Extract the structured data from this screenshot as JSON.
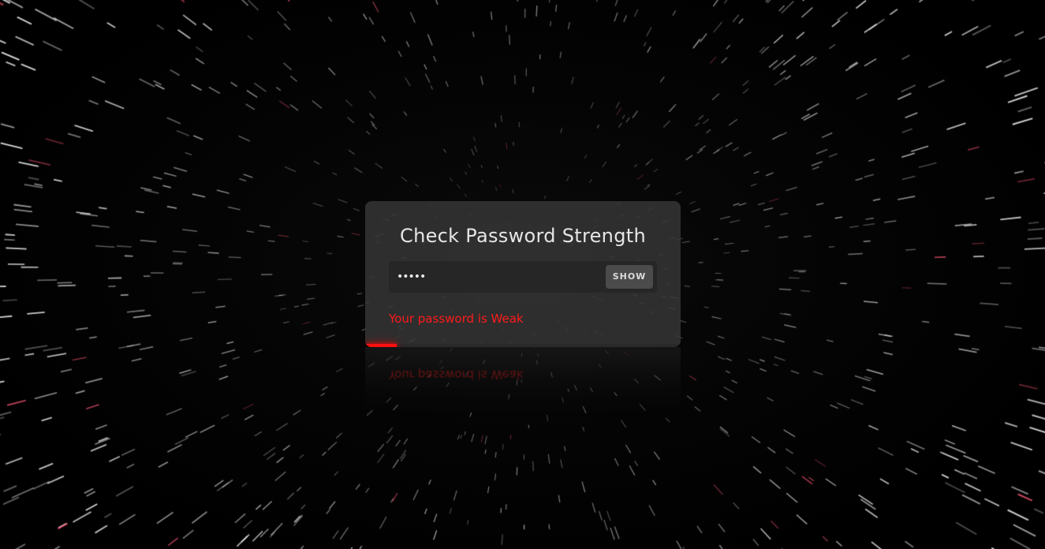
{
  "card": {
    "title": "Check Password Strength",
    "password_value": "•••••",
    "show_label": "SHOW",
    "status_text": "Your password is Weak"
  },
  "strength_meter": {
    "level": "Weak",
    "fill_fraction": 0.1,
    "color": "#ff1010"
  },
  "theme": {
    "background": "#000000",
    "card_background": "#3a3a3a",
    "accent_red": "#ff1a1a"
  },
  "icons": {
    "show_toggle": "eye-toggle-text"
  }
}
